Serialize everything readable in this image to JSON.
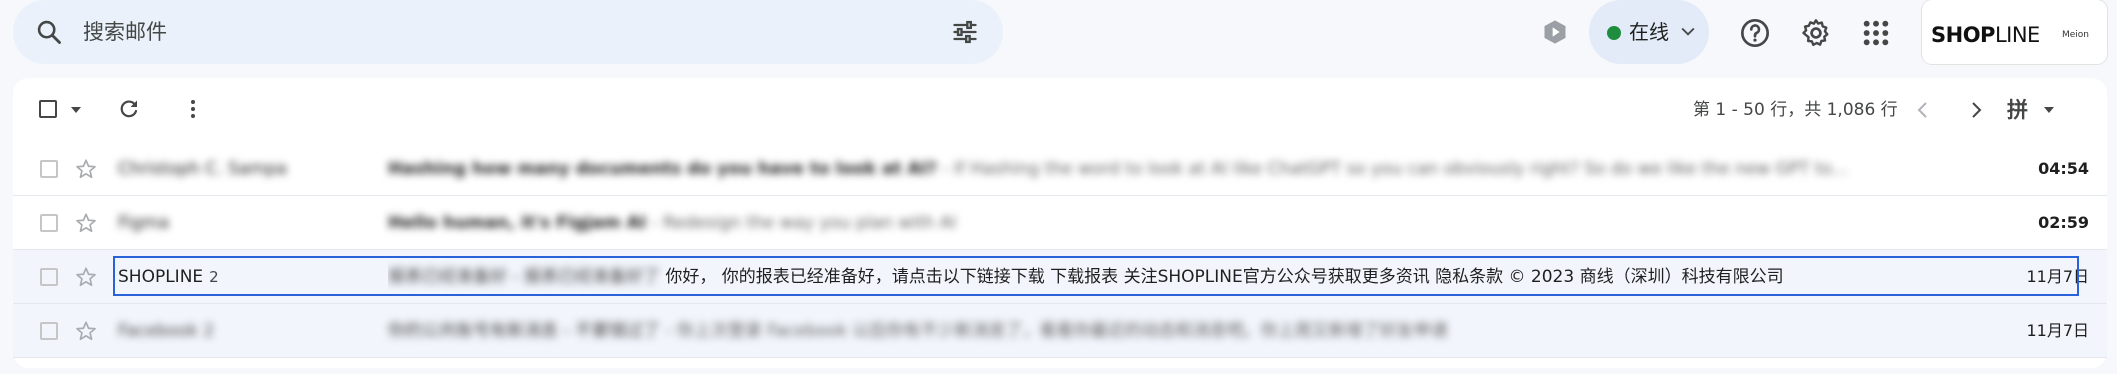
{
  "search": {
    "placeholder": "搜索邮件"
  },
  "status": {
    "label": "在线"
  },
  "account": {
    "brand_bold": "SHOPLINE",
    "brand_sub": "Meion"
  },
  "toolbar": {
    "pagination": "第 1 - 50 行，共 1,086 行",
    "input_method": "拼"
  },
  "emails": [
    {
      "sender": "Christoph C. Sampa",
      "subject": "Hashing how many documents do you have to look at AI?",
      "snippet": " - If Hashing the word to look at AI like ChatGPT so you can obviously right? So do we like the new GPT to...",
      "date": "04:54",
      "unread": true
    },
    {
      "sender": "Figma",
      "subject": "Hello human, it's Figjam AI",
      "snippet": " - Redesign the way you plan with AI",
      "date": "02:59",
      "unread": true
    },
    {
      "sender": "SHOPLINE",
      "count": "2",
      "subject": "报表已经准备好",
      "subject2": "报表已经准备好了",
      "snippet": "你好， 你的报表已经准备好，请点击以下链接下载 下载报表 关注SHOPLINE官方公众号获取更多资讯 隐私条款 © 2023 商线（深圳）科技有限公司",
      "date": "11月7日",
      "unread": false
    },
    {
      "sender": "Facebook 2",
      "subject": "你的公共账号有新消息 - 不要错过了",
      "snippet": " - 你上次登录 Facebook 以后你有不少新消息了，看看你最近的动态和消息吧。你上周又新增了好友申请",
      "date": "11月7日",
      "unread": false
    }
  ],
  "colors": {
    "accent": "#2962d9",
    "status_online": "#1e8e3e",
    "background": "#f6f8fc"
  }
}
